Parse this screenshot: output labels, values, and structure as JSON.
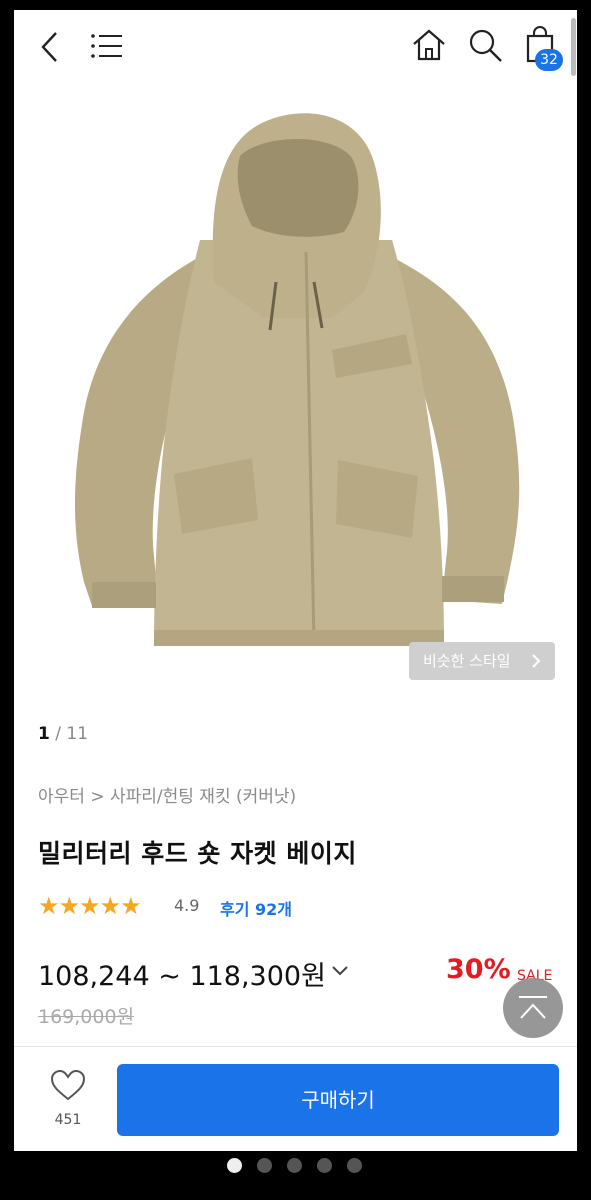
{
  "header": {
    "cart_count": "32"
  },
  "product": {
    "similar_style_label": "비슷한 스타일",
    "image_index": "1",
    "image_total": "11",
    "category_path": "아우터 > 사파리/헌팅 재킷 (커버낫)",
    "title": "밀리터리 후드 숏 자켓 베이지",
    "stars": "★★★★★",
    "rating": "4.9",
    "reviews_label": "후기 92개",
    "price_range": "108,244 ~ 118,300원",
    "discount_percent": "30%",
    "sale_label": "SALE",
    "original_price": "169,000원"
  },
  "bottom_bar": {
    "like_count": "451",
    "buy_label": "구매하기"
  },
  "colors": {
    "accent": "#1a73e8",
    "discount": "#e31b23",
    "star": "#f5a623",
    "jacket": "#bfb28e"
  },
  "icons": [
    "back-icon",
    "menu-icon",
    "home-icon",
    "search-icon",
    "shopping-bag-icon",
    "chevron-right-icon",
    "chevron-down-icon",
    "scroll-top-icon",
    "heart-icon"
  ]
}
